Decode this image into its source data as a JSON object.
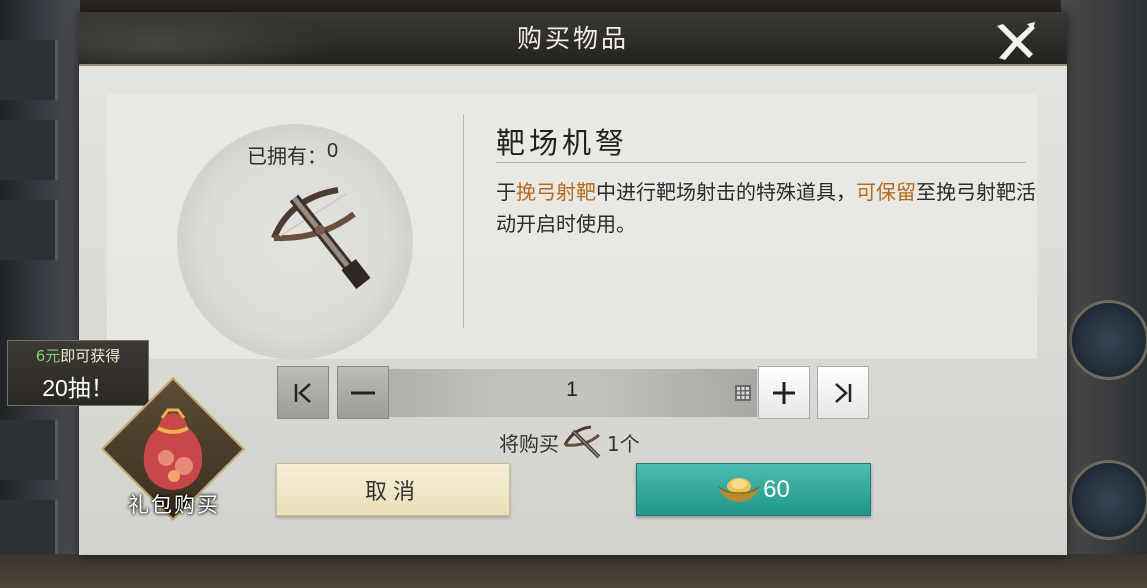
{
  "dialog": {
    "title": "购买物品",
    "close_icon": "close-x-icon"
  },
  "item": {
    "owned_label": "已拥有：",
    "owned_count": "0",
    "name": "靶场机弩",
    "icon": "crossbow-icon",
    "description": {
      "part1": "于",
      "highlight1": "挽弓射靶",
      "part2": "中进行靶场射击的特殊道具，",
      "highlight2": "可保留",
      "part3": "至挽弓射靶活动开启时使用。"
    },
    "highlight_color": "#b5691b"
  },
  "quantity": {
    "value": "1",
    "min_button_icon": "skip-to-min-icon",
    "minus_button_icon": "minus-icon",
    "plus_button_icon": "plus-icon",
    "max_button_icon": "skip-to-max-icon",
    "keypad_icon": "keypad-icon"
  },
  "summary": {
    "prefix": "将购买",
    "count": "1个"
  },
  "actions": {
    "cancel_label": "取消",
    "buy_price": "60",
    "currency_icon": "gold-ingot-icon",
    "buy_color": "#2aa99c"
  },
  "promo": {
    "price_text": "6元",
    "line1_suffix": "即可获得",
    "line2": "20抽！",
    "gift_label": "礼包购买",
    "gift_icon": "gift-bag-icon"
  }
}
